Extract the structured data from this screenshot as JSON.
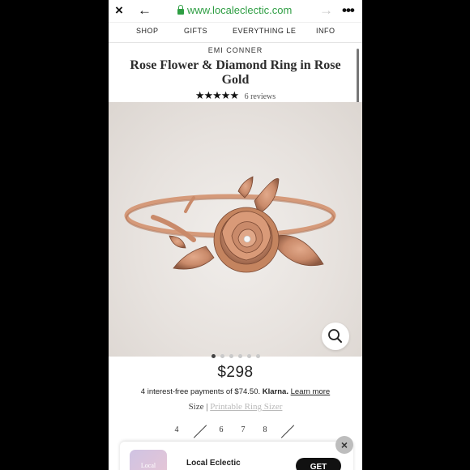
{
  "browser": {
    "close_icon": "×",
    "back_icon": "←",
    "url": "www.localeclectic.com",
    "forward_icon": "→",
    "more_icon": "•••"
  },
  "nav": {
    "shop": "SHOP",
    "gifts": "GIFTS",
    "everything": "EVERYTHING LE",
    "info": "INFO"
  },
  "product": {
    "brand": "EMI CONNER",
    "title": "Rose Flower & Diamond Ring in Rose Gold",
    "stars": "★★★★★",
    "rating": 4.5,
    "reviews": "6 reviews",
    "price": "$298",
    "installments_text": "4 interest-free payments of $74.50.",
    "klarna": "Klarna.",
    "learn_more": "Learn more",
    "size_label": "Size |",
    "size_guide": "Printable Ring Sizer",
    "image_count": 6,
    "active_image": 1
  },
  "sizes": [
    {
      "label": "4",
      "available": true
    },
    {
      "label": "",
      "available": false
    },
    {
      "label": "6",
      "available": true
    },
    {
      "label": "7",
      "available": true
    },
    {
      "label": "8",
      "available": true
    },
    {
      "label": "",
      "available": false
    }
  ],
  "app_banner": {
    "logo_text": "Local",
    "name": "Local Eclectic",
    "get_label": "GET",
    "close_icon": "×"
  },
  "colors": {
    "url_green": "#2e9e43",
    "rose_gold": "#c98a6a",
    "background": "#000000"
  }
}
